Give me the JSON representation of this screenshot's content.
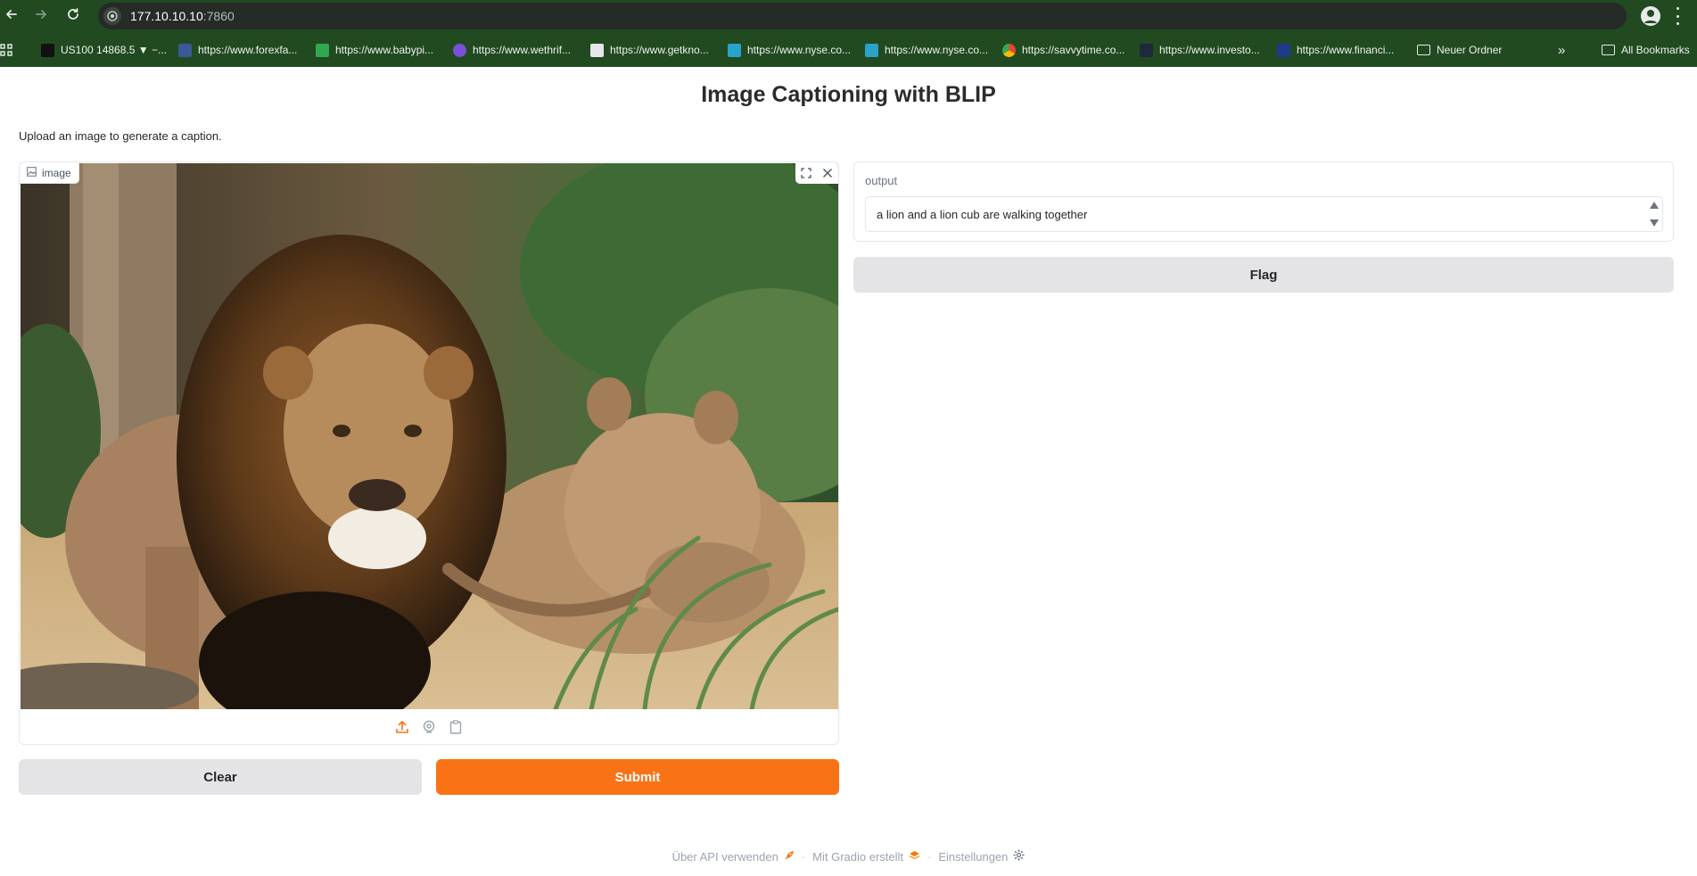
{
  "browser": {
    "url_host": "177.10.10.10",
    "url_port": ":7860",
    "bookmarks": [
      {
        "label": "US100 14868.5 ▼ −...",
        "icon": "tradingview-icon",
        "color": "#111111"
      },
      {
        "label": "https://www.forexfa...",
        "icon": "forexfactory-icon",
        "color": "#3b5998"
      },
      {
        "label": "https://www.babypi...",
        "icon": "babypips-icon",
        "color": "#2fa84f"
      },
      {
        "label": "https://www.wethrif...",
        "icon": "wethrift-icon",
        "color": "#7b4fd6"
      },
      {
        "label": "https://www.getkno...",
        "icon": "getknowledge-icon",
        "color": "#e5e7eb"
      },
      {
        "label": "https://www.nyse.co...",
        "icon": "nyse-icon",
        "color": "#2aa3c9"
      },
      {
        "label": "https://www.nyse.co...",
        "icon": "nyse-icon",
        "color": "#2aa3c9"
      },
      {
        "label": "https://savvytime.co...",
        "icon": "chrome-icon",
        "color": "#4285f4"
      },
      {
        "label": "https://www.investo...",
        "icon": "investopedia-icon",
        "color": "#1e293b"
      },
      {
        "label": "https://www.financi...",
        "icon": "financial-icon",
        "color": "#1e3a8a"
      },
      {
        "label": "Neuer Ordner",
        "icon": "folder-icon",
        "color": "#e6ebe6"
      }
    ],
    "all_bookmarks": "All Bookmarks"
  },
  "app": {
    "title": "Image Captioning with BLIP",
    "description": "Upload an image to generate a caption.",
    "image_label": "image",
    "output_label": "output",
    "output_value": "a lion and a lion cub are walking together",
    "clear_label": "Clear",
    "submit_label": "Submit",
    "flag_label": "Flag",
    "accent_color": "#f97316"
  },
  "footer": {
    "api": "Über API verwenden",
    "gradio": "Mit Gradio erstellt",
    "settings": "Einstellungen"
  }
}
